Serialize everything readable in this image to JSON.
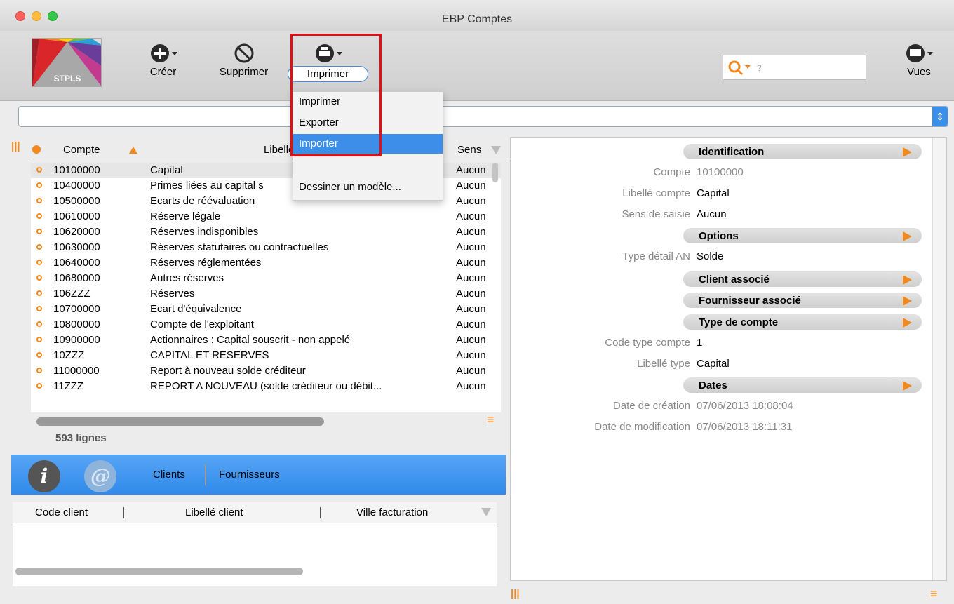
{
  "window": {
    "title": "EBP Comptes"
  },
  "logo": {
    "text": "STPLS"
  },
  "toolbar": {
    "create_label": "Créer",
    "delete_label": "Supprimer",
    "print_label": "Imprimer",
    "views_label": "Vues",
    "search_placeholder": "?"
  },
  "print_menu": {
    "items": [
      "Imprimer",
      "Exporter",
      "Importer",
      "",
      "Dessiner un modèle..."
    ],
    "selected": "Importer"
  },
  "accounts_table": {
    "columns": [
      "Compte",
      "Libellé",
      "Sens"
    ],
    "rows": [
      {
        "compte": "10100000",
        "libelle": "Capital",
        "sens": "Aucun"
      },
      {
        "compte": "10400000",
        "libelle": "Primes liées au capital s",
        "sens": "Aucun"
      },
      {
        "compte": "10500000",
        "libelle": "Ecarts de réévaluation",
        "sens": "Aucun"
      },
      {
        "compte": "10610000",
        "libelle": "Réserve légale",
        "sens": "Aucun"
      },
      {
        "compte": "10620000",
        "libelle": "Réserves indisponibles",
        "sens": "Aucun"
      },
      {
        "compte": "10630000",
        "libelle": "Réserves statutaires ou contractuelles",
        "sens": "Aucun"
      },
      {
        "compte": "10640000",
        "libelle": "Réserves réglementées",
        "sens": "Aucun"
      },
      {
        "compte": "10680000",
        "libelle": "Autres réserves",
        "sens": "Aucun"
      },
      {
        "compte": "106ZZZ",
        "libelle": "Réserves",
        "sens": "Aucun"
      },
      {
        "compte": "10700000",
        "libelle": "Ecart d'équivalence",
        "sens": "Aucun"
      },
      {
        "compte": "10800000",
        "libelle": "Compte de l'exploitant",
        "sens": "Aucun"
      },
      {
        "compte": "10900000",
        "libelle": "Actionnaires : Capital souscrit - non appelé",
        "sens": "Aucun"
      },
      {
        "compte": "10ZZZ",
        "libelle": "CAPITAL ET RESERVES",
        "sens": "Aucun"
      },
      {
        "compte": "11000000",
        "libelle": "Report à nouveau solde créditeur",
        "sens": "Aucun"
      },
      {
        "compte": "11ZZZ",
        "libelle": "REPORT A NOUVEAU (solde créditeur ou débit...",
        "sens": "Aucun"
      }
    ],
    "line_count": "593 lignes"
  },
  "bottom_tabs": {
    "info_icon": "i",
    "at_icon": "@",
    "clients": "Clients",
    "fournisseurs": "Fournisseurs"
  },
  "clients_table": {
    "columns": [
      "Code client",
      "Libellé client",
      "Ville facturation"
    ]
  },
  "details": {
    "sections": {
      "identification": "Identification",
      "options": "Options",
      "client": "Client associé",
      "fournisseur": "Fournisseur associé",
      "type_compte": "Type de compte",
      "dates": "Dates"
    },
    "fields": {
      "compte_label": "Compte",
      "compte_value": "10100000",
      "libelle_label": "Libellé compte",
      "libelle_value": "Capital",
      "sens_label": "Sens de saisie",
      "sens_value": "Aucun",
      "type_an_label": "Type détail AN",
      "type_an_value": "Solde",
      "code_type_label": "Code type compte",
      "code_type_value": "1",
      "libelle_type_label": "Libellé type",
      "libelle_type_value": "Capital",
      "creation_label": "Date de création",
      "creation_value": "07/06/2013 18:08:04",
      "modification_label": "Date de modification",
      "modification_value": "07/06/2013 18:11:31"
    }
  }
}
